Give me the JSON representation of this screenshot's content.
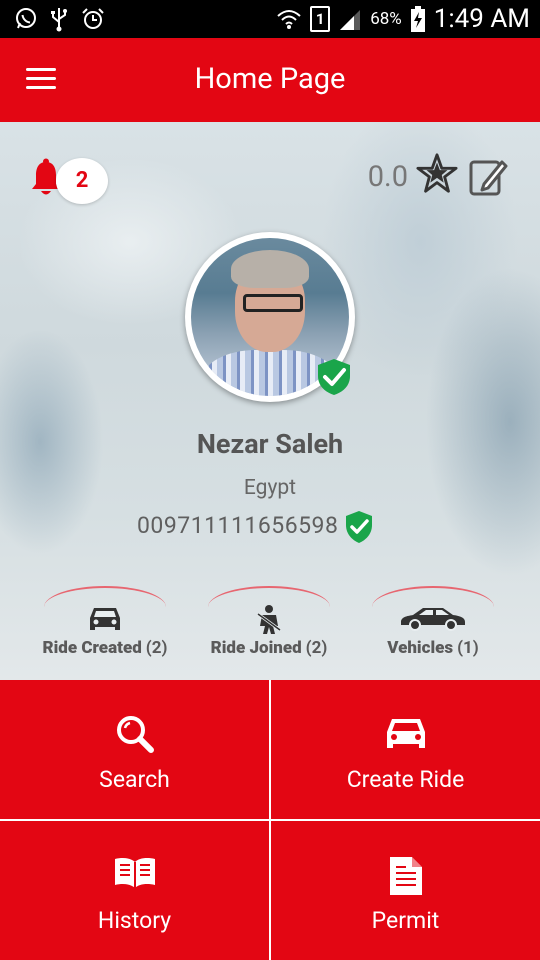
{
  "status_bar": {
    "battery": "68%",
    "sim": "1",
    "time": "1:49 AM"
  },
  "app_bar": {
    "title": "Home Page"
  },
  "profile": {
    "notifications_count": "2",
    "rating": "0.0",
    "name": "Nezar Saleh",
    "country": "Egypt",
    "phone": "009711111656598",
    "stats": [
      {
        "label": "Ride Created",
        "count": "(2)",
        "icon": "car-front-icon"
      },
      {
        "label": "Ride Joined",
        "count": "(2)",
        "icon": "seat-belt-icon"
      },
      {
        "label": "Vehicles",
        "count": "(1)",
        "icon": "car-side-icon"
      }
    ]
  },
  "actions": [
    {
      "label": "Search",
      "icon": "search-icon"
    },
    {
      "label": "Create Ride",
      "icon": "car-front-icon"
    },
    {
      "label": "History",
      "icon": "book-icon"
    },
    {
      "label": "Permit",
      "icon": "document-icon"
    }
  ],
  "colors": {
    "brand_red": "#e30613",
    "verified_green": "#1aa54a",
    "text_gray": "#555555"
  }
}
